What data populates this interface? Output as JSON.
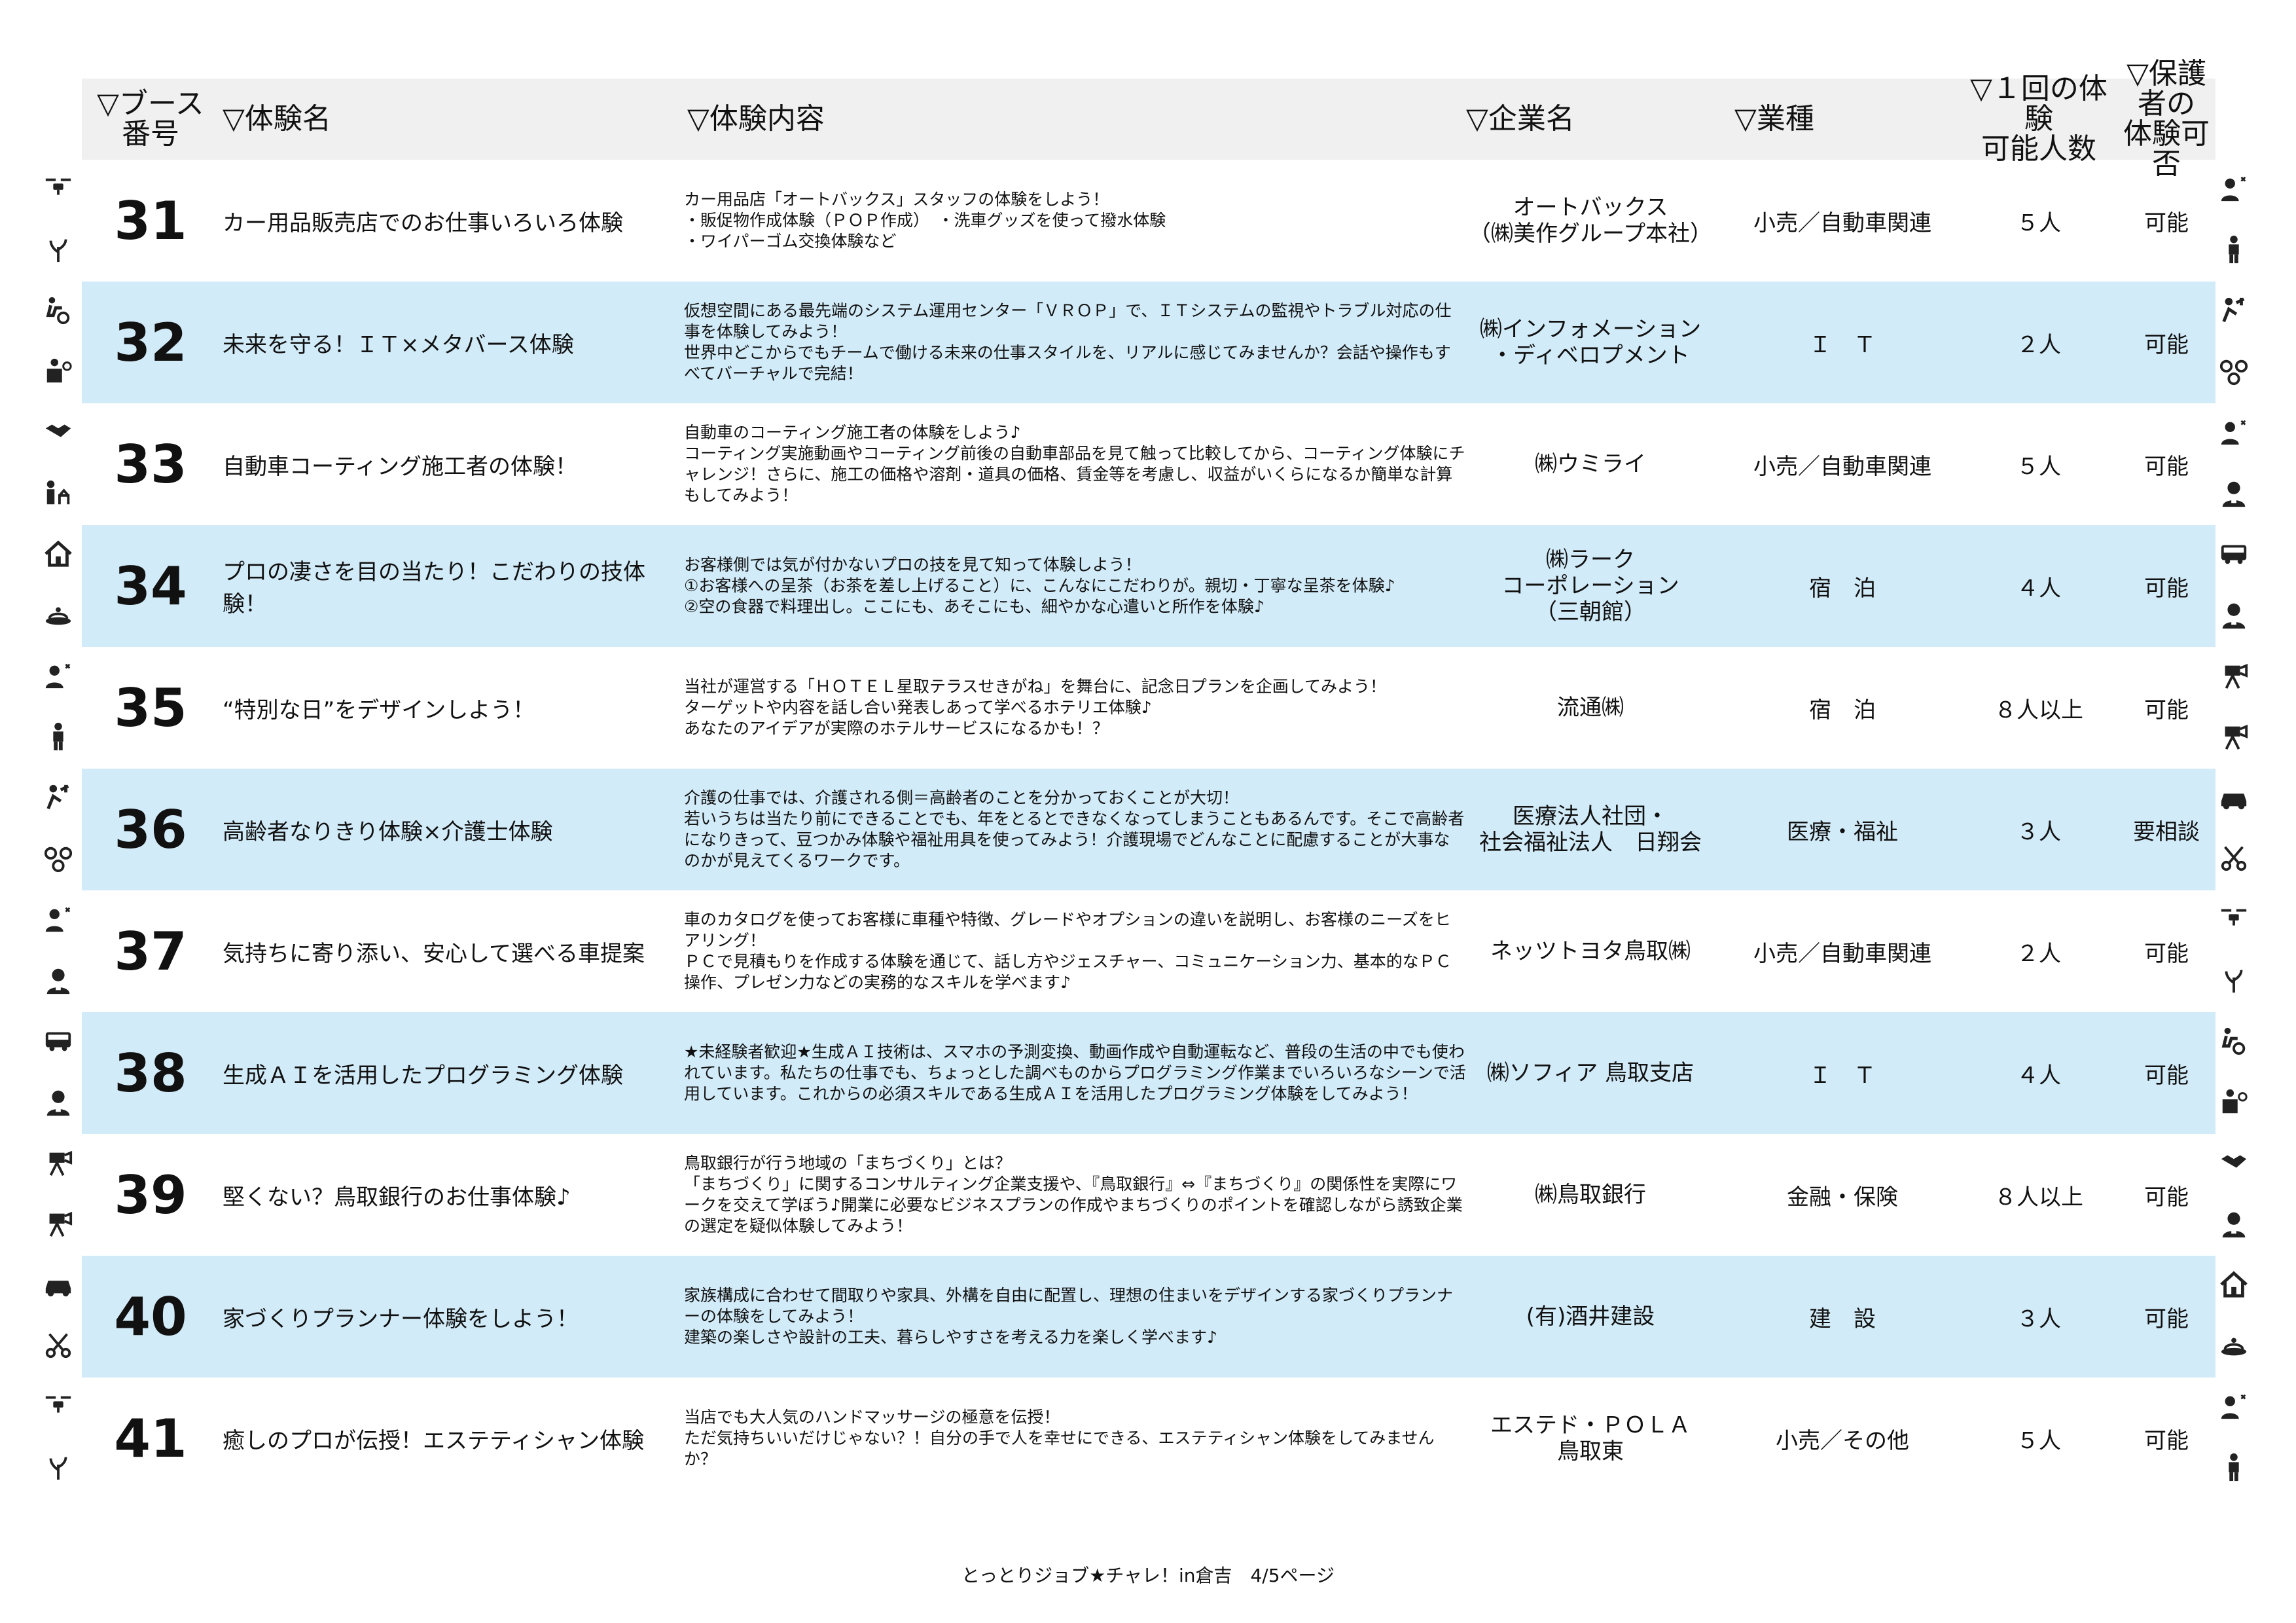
{
  "header": {
    "booth": "▽ブース\n番号",
    "name": "▽体験名",
    "content": "▽体験内容",
    "company": "▽企業名",
    "industry": "▽業種",
    "capacity": "▽１回の体験\n可能人数",
    "guardian": "▽保護者の\n体験可否"
  },
  "rows": [
    {
      "num": "31",
      "name": "カー用品販売店でのお仕事いろいろ体験",
      "desc": "カー用品店「オートバックス」スタッフの体験をしよう！\n・販促物作成体験（ＰＯＰ作成）　・洗車グッズを使って撥水体験\n・ワイパーゴム交換体験など",
      "company": "オートバックス\n（㈱美作グループ本社）",
      "industry": "小売／自動車関連",
      "capacity": "５人",
      "guardian": "可能"
    },
    {
      "num": "32",
      "name": "未来を守る！ＩＴ×メタバース体験",
      "desc": "仮想空間にある最先端のシステム運用センター「ＶＲＯＰ」で、ＩＴシステムの監視やトラブル対応の仕事を体験してみよう！\n世界中どこからでもチームで働ける未来の仕事スタイルを、リアルに感じてみませんか？会話や操作もすべてバーチャルで完結！",
      "company": "㈱インフォメーション\n・ディベロプメント",
      "industry": "Ｉ　Ｔ",
      "capacity": "２人",
      "guardian": "可能"
    },
    {
      "num": "33",
      "name": "自動車コーティング施工者の体験！",
      "desc": "自動車のコーティング施工者の体験をしよう♪\nコーティング実施動画やコーティング前後の自動車部品を見て触って比較してから、コーティング体験にチャレンジ！さらに、施工の価格や溶剤・道具の価格、賃金等を考慮し、収益がいくらになるか簡単な計算もしてみよう！",
      "company": "㈱ウミライ",
      "industry": "小売／自動車関連",
      "capacity": "５人",
      "guardian": "可能"
    },
    {
      "num": "34",
      "name": "プロの凄さを目の当たり！こだわりの技体験！",
      "desc": "お客様側では気が付かないプロの技を見て知って体験しよう！\n①お客様への呈茶（お茶を差し上げること）に、こんなにこだわりが。親切・丁寧な呈茶を体験♪\n②空の食器で料理出し。ここにも、あそこにも、細やかな心遣いと所作を体験♪",
      "company": "㈱ラーク\nコーポレーション\n（三朝館）",
      "industry": "宿　泊",
      "capacity": "４人",
      "guardian": "可能"
    },
    {
      "num": "35",
      "name": "“特別な日”をデザインしよう！",
      "desc": "当社が運営する「ＨＯＴＥＬ星取テラスせきがね」を舞台に、記念日プランを企画してみよう！\nターゲットや内容を話し合い発表しあって学べるホテリエ体験♪\nあなたのアイデアが実際のホテルサービスになるかも！？",
      "company": "流通㈱",
      "industry": "宿　泊",
      "capacity": "８人以上",
      "guardian": "可能"
    },
    {
      "num": "36",
      "name": "高齢者なりきり体験×介護士体験",
      "desc": "介護の仕事では、介護される側＝高齢者のことを分かっておくことが大切！\n若いうちは当たり前にできることでも、年をとるとできなくなってしまうこともあるんです。そこで高齢者になりきって、豆つかみ体験や福祉用具を使ってみよう！介護現場でどんなことに配慮することが大事なのかが見えてくるワークです。",
      "company": "医療法人社団・\n社会福祉法人　日翔会",
      "industry": "医療・福祉",
      "capacity": "３人",
      "guardian": "要相談"
    },
    {
      "num": "37",
      "name": "気持ちに寄り添い、安心して選べる車提案",
      "desc": "車のカタログを使ってお客様に車種や特徴、グレードやオプションの違いを説明し、お客様のニーズをヒアリング！\nＰＣで見積もりを作成する体験を通じて、話し方やジェスチャー、コミュニケーション力、基本的なＰＣ操作、プレゼン力などの実務的なスキルを学べます♪",
      "company": "ネッツトヨタ鳥取㈱",
      "industry": "小売／自動車関連",
      "capacity": "２人",
      "guardian": "可能"
    },
    {
      "num": "38",
      "name": "生成ＡＩを活用したプログラミング体験",
      "desc": "★未経験者歓迎★生成ＡＩ技術は、スマホの予測変換、動画作成や自動運転など、普段の生活の中でも使われています。私たちの仕事でも、ちょっとした調べものからプログラミング作業までいろいろなシーンで活用しています。これからの必須スキルである生成ＡＩを活用したプログラミング体験をしてみよう！",
      "company": "㈱ソフィア 鳥取支店",
      "industry": "Ｉ　Ｔ",
      "capacity": "４人",
      "guardian": "可能"
    },
    {
      "num": "39",
      "name": "堅くない？鳥取銀行のお仕事体験♪",
      "desc": "鳥取銀行が行う地域の「まちづくり」とは？\n「まちづくり」に関するコンサルティング企業支援や、『鳥取銀行』⇔『まちづくり』の関係性を実際にワークを交えて学ぼう♪開業に必要なビジネスプランの作成やまちづくりのポイントを確認しながら誘致企業の選定を疑似体験してみよう！",
      "company": "㈱鳥取銀行",
      "industry": "金融・保険",
      "capacity": "８人以上",
      "guardian": "可能"
    },
    {
      "num": "40",
      "name": "家づくりプランナー体験をしよう！",
      "desc": "家族構成に合わせて間取りや家具、外構を自由に配置し、理想の住まいをデザインする家づくりプランナーの体験をしてみよう！\n建築の楽しさや設計の工夫、暮らしやすさを考える力を楽しく学べます♪",
      "company": "(有)酒井建設",
      "industry": "建　設",
      "capacity": "３人",
      "guardian": "可能"
    },
    {
      "num": "41",
      "name": "癒しのプロが伝授！エステティシャン体験",
      "desc": "当店でも大人気のハンドマッサージの極意を伝授！\nただ気持ちいいだけじゃない？！自分の手で人を幸せにできる、エステティシャン体験をしてみませんか？",
      "company": "エステド・ＰＯＬＡ\n鳥取東",
      "industry": "小売／その他",
      "capacity": "５人",
      "guardian": "可能"
    }
  ],
  "footer": "とっとりジョブ★チャレ！in倉吉　4/5ページ",
  "colors": {
    "header_bg": "#f0f0f0",
    "alt_row_bg": "#d2ebf8"
  }
}
